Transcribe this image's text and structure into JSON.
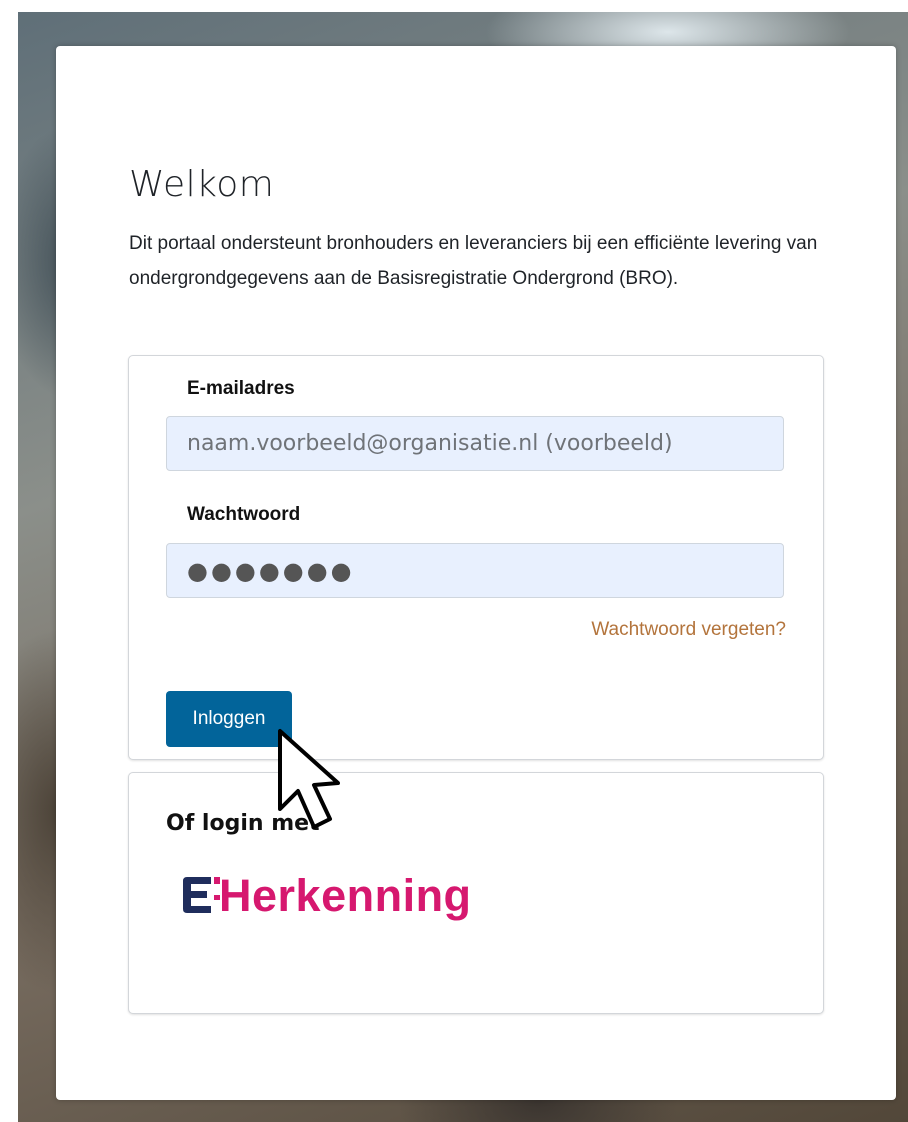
{
  "page": {
    "title": "Welkom",
    "intro": "Dit portaal ondersteunt bronhouders en leveranciers bij een efficiënte levering van ondergrondgegevens aan de Basisregistratie Ondergrond (BRO)."
  },
  "login": {
    "email_label": "E-mailadres",
    "email_placeholder": "naam.voorbeeld@organisatie.nl (voorbeeld)",
    "password_label": "Wachtwoord",
    "password_value": "●●●●●●●",
    "forgot_link": "Wachtwoord vergeten?",
    "submit_label": "Inloggen"
  },
  "alternative": {
    "title": "Of login met",
    "eherkenning_logo": "EHerkenning",
    "eherkenning_logo_text": "Herkenning"
  },
  "colors": {
    "primary_button": "#02649a",
    "link": "#b3743c",
    "eherkenning_pink": "#d6186f",
    "eherkenning_navy": "#1f2d5c",
    "input_background": "#e8f0fe"
  },
  "icons": {
    "pointer": "mouse-pointer-icon",
    "eherkenning_mark": "eherkenning-e-icon"
  }
}
